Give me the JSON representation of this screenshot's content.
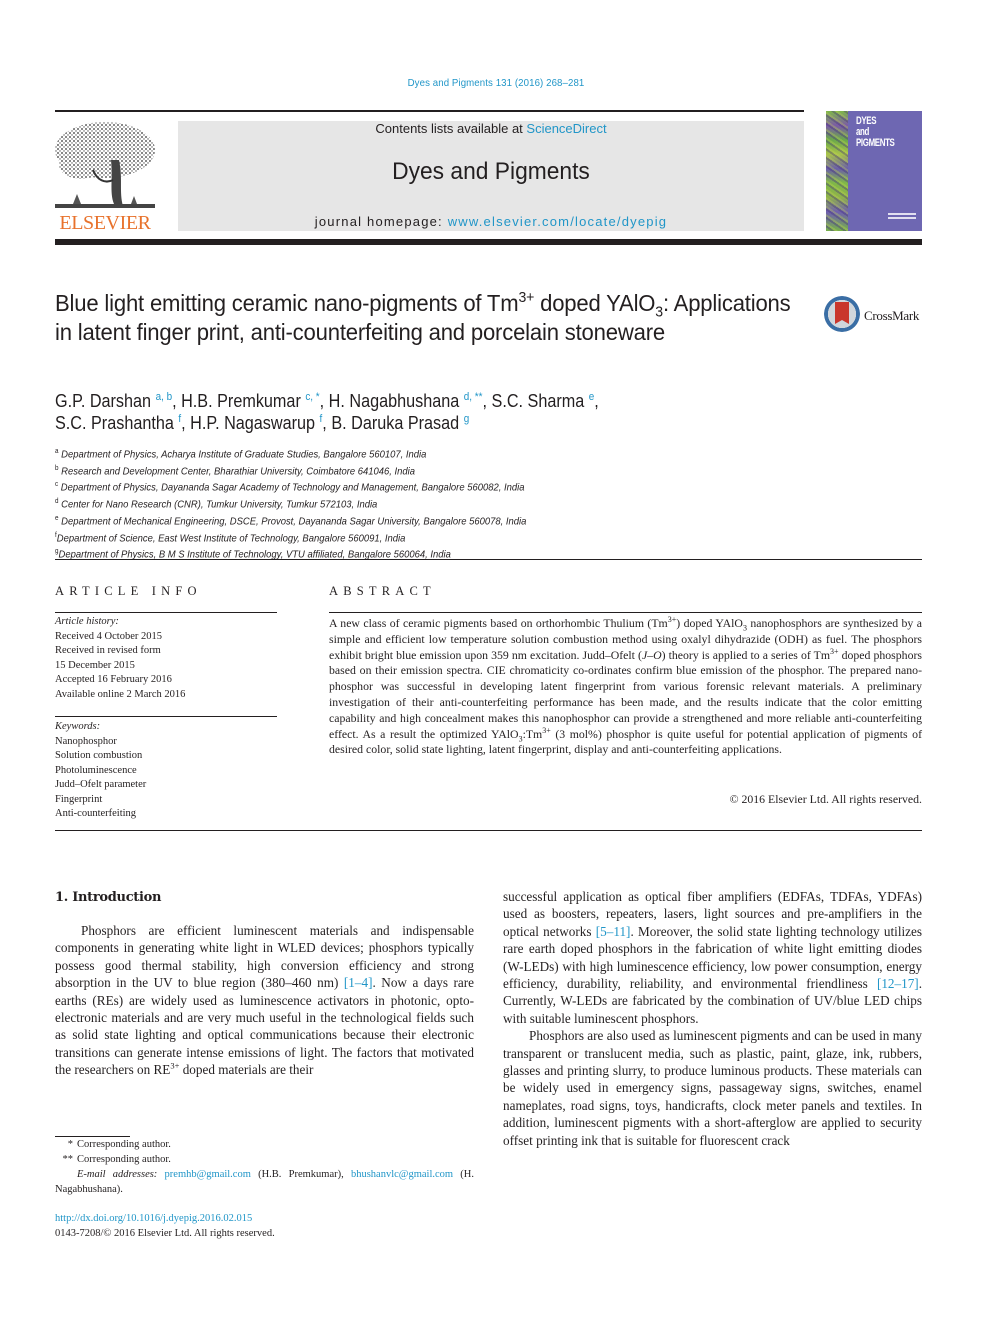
{
  "header": {
    "journal_ref": "Dyes and Pigments 131 (2016) 268–281",
    "contents_prefix": "Contents lists available at ",
    "contents_link": "ScienceDirect",
    "journal_name": "Dyes and Pigments",
    "homepage_prefix": "journal homepage: ",
    "homepage_link": "www.elsevier.com/locate/dyepig",
    "publisher_logo_text": "ELSEVIER",
    "cover_title_lines": [
      "DYES",
      "and",
      "PIGMENTS"
    ]
  },
  "crossmark": {
    "label": "CrossMark"
  },
  "article": {
    "title_part1": "Blue light emitting ceramic nano-pigments of Tm",
    "title_sup1": "3+",
    "title_part2": " doped YAlO",
    "title_sub1": "3",
    "title_part3": ": Applications in latent finger print, anti-counterfeiting and porcelain stoneware",
    "authors": [
      {
        "name": "G.P. Darshan",
        "marks": "a, b",
        "sep": ", "
      },
      {
        "name": "H.B. Premkumar",
        "marks": "c, *",
        "sep": ", "
      },
      {
        "name": "H. Nagabhushana",
        "marks": "d, **",
        "sep": ", "
      },
      {
        "name": "S.C. Sharma",
        "marks": "e",
        "sep": ","
      },
      {
        "name": "S.C. Prashantha",
        "marks": "f",
        "sep": ", "
      },
      {
        "name": "H.P. Nagaswarup",
        "marks": "f",
        "sep": ", "
      },
      {
        "name": "B. Daruka Prasad",
        "marks": "g",
        "sep": ""
      }
    ],
    "affiliations": [
      {
        "key": "a",
        "text": "Department of Physics, Acharya Institute of Graduate Studies, Bangalore 560107, India"
      },
      {
        "key": "b",
        "text": "Research and Development Center, Bharathiar University, Coimbatore 641046, India"
      },
      {
        "key": "c",
        "text": "Department of Physics, Dayananda Sagar Academy of Technology and Management, Bangalore 560082, India"
      },
      {
        "key": "d",
        "text": "Center for Nano Research (CNR), Tumkur University, Tumkur 572103, India"
      },
      {
        "key": "e",
        "text": "Department of Mechanical Engineering, DSCE, Provost, Dayananda Sagar University, Bangalore 560078, India"
      },
      {
        "key": "f",
        "text": "Department of Science, East West Institute of Technology, Bangalore 560091, India"
      },
      {
        "key": "g",
        "text": "Department of Physics, B M S Institute of Technology, VTU affiliated, Bangalore 560064, India"
      }
    ]
  },
  "article_info": {
    "heading": "ARTICLE INFO",
    "history_label": "Article history:",
    "history": [
      "Received 4 October 2015",
      "Received in revised form",
      "15 December 2015",
      "Accepted 16 February 2016",
      "Available online 2 March 2016"
    ],
    "keywords_label": "Keywords:",
    "keywords": [
      "Nanophosphor",
      "Solution combustion",
      "Photoluminescence",
      "Judd–Ofelt parameter",
      "Fingerprint",
      "Anti-counterfeiting"
    ]
  },
  "abstract": {
    "heading": "ABSTRACT",
    "t1": "A new class of ceramic pigments based on orthorhombic Thulium (Tm",
    "s1": "3+",
    "t2": ") doped YAlO",
    "b1": "3",
    "t3": " nanophosphors are synthesized by a simple and efficient low temperature solution combustion method using oxalyl dihydrazide (ODH) as fuel. The phosphors exhibit bright blue emission upon 359 nm excitation. Judd–Ofelt (",
    "i1": "J–O",
    "t4": ") theory is applied to a series of Tm",
    "s2": "3+",
    "t5": " doped phosphors based on their emission spectra. CIE chromaticity co-ordinates confirm blue emission of the phosphor. The prepared nano-phosphor was successful in developing latent fingerprint from various forensic relevant materials. A preliminary investigation of their anti-counterfeiting performance has been made, and the results indicate that the color emitting capability and high concealment makes this nanophosphor can provide a strengthened and more reliable anti-counterfeiting effect. As a result the optimized YAlO",
    "b2": "3",
    "t6": ":Tm",
    "s3": "3+",
    "t7": " (3 mol%) phosphor is quite useful for potential application of pigments of desired color, solid state lighting, latent fingerprint, display and anti-counterfeiting applications.",
    "copyright": "© 2016 Elsevier Ltd. All rights reserved."
  },
  "intro": {
    "heading": "1.  Introduction",
    "left_p1a": "Phosphors are efficient luminescent materials and indispensable components in generating white light in WLED devices; phosphors typically possess good thermal stability, high conversion efficiency and strong absorption in the UV to blue region (380–460 nm) ",
    "left_ref1": "[1–4]",
    "left_p1b": ". Now a days rare earths (REs) are widely used as luminescence activators in photonic, opto-electronic materials and are very much useful in the technological fields such as solid state lighting and optical communications because their electronic transitions can generate intense emissions of light. The factors that motivated the researchers on RE",
    "left_sup": "3+",
    "left_p1c": " doped materials are their",
    "right_p1a": "successful application as optical fiber amplifiers (EDFAs, TDFAs, YDFAs) used as boosters, repeaters, lasers, light sources and pre-amplifiers in the optical networks ",
    "right_ref1": "[5–11]",
    "right_p1b": ". Moreover, the solid state lighting technology utilizes rare earth doped phosphors in the fabrication of white light emitting diodes (W-LEDs) with high luminescence efficiency, low power consumption, energy efficiency, durability, reliability, and environmental friendliness ",
    "right_ref2": "[12–17]",
    "right_p1c": ". Currently, W-LEDs are fabricated by the combination of UV/blue LED chips with suitable luminescent phosphors.",
    "right_p2": "Phosphors are also used as luminescent pigments and can be used in many transparent or translucent media, such as plastic, paint, glaze, ink, rubbers, glasses and printing slurry, to produce luminous products. These materials can be widely used in emergency signs, passageway signs, switches, enamel nameplates, road signs, toys, handicrafts, clock meter panels and textiles. In addition, luminescent pigments with a short-afterglow are applied to security offset printing ink that is suitable for fluorescent crack"
  },
  "footnotes": {
    "star1_mark": "*",
    "star1_text": "Corresponding author.",
    "star2_mark": "**",
    "star2_text": "Corresponding author.",
    "email_label": "E-mail addresses:",
    "email1": "premhb@gmail.com",
    "email1_owner": " (H.B. Premkumar), ",
    "email2": "bhushanvlc@gmail.com",
    "email2_owner": " (H. Nagabhushana).",
    "doi": "http://dx.doi.org/10.1016/j.dyepig.2016.02.015",
    "issn": "0143-7208/© 2016 Elsevier Ltd. All rights reserved."
  }
}
